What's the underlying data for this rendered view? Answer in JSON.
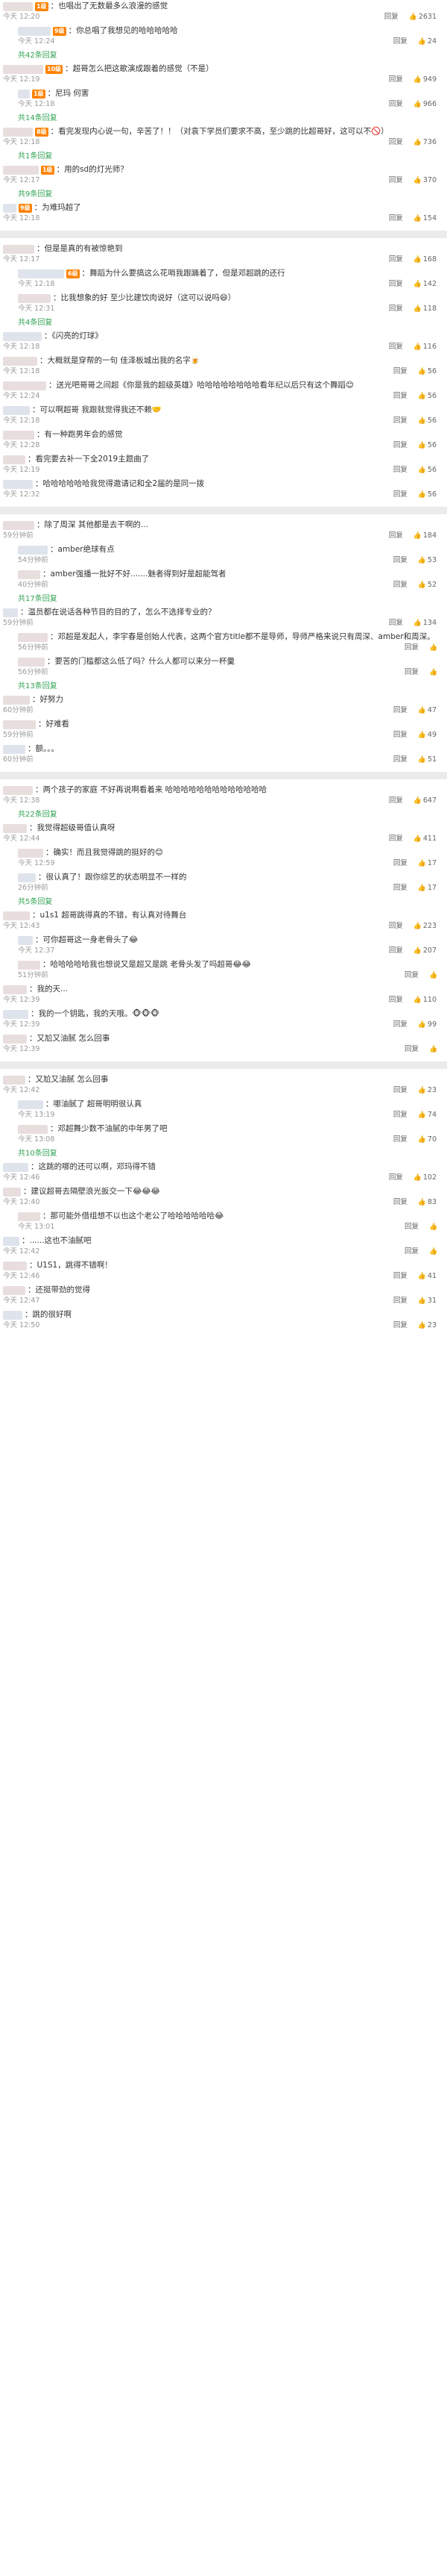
{
  "reply_label": "回复",
  "blocks": [
    {
      "rows": [
        {
          "reply": false,
          "name_w": 40,
          "badge": "1级",
          "text": "：也唱出了无数最多么浪漫的感觉",
          "time": "今天 12:20",
          "likes": "2631"
        },
        {
          "reply": true,
          "name_w": 44,
          "badge": "9级",
          "text": "：你总唱了我想见的哈哈哈哈哈",
          "time": "今天 12:24",
          "likes": "24"
        },
        {
          "more": "共42条回复",
          "reply": true
        },
        {
          "reply": false,
          "name_w": 54,
          "badge": "10级",
          "text": "：超哥怎么把这歌演成跟着的感觉（不是）",
          "time": "今天 12:19",
          "likes": "949"
        },
        {
          "reply": true,
          "name_w": 16,
          "badge": "1级",
          "text": "：尼玛 何害",
          "time": "今天 12:18",
          "likes": "966"
        },
        {
          "more": "共14条回复",
          "reply": true
        },
        {
          "reply": false,
          "name_w": 40,
          "badge": "8级",
          "text": "：看完发现内心说一句，辛苦了！！（对袁下学员们要求不高，至少跳的比超哥好，这可以不🚫）",
          "time": "今天 12:18",
          "likes": "736"
        },
        {
          "more": "共1条回复",
          "reply": true
        },
        {
          "reply": false,
          "name_w": 48,
          "badge": "1级",
          "text": "：用的sd的灯光师？",
          "time": "今天 12:17",
          "likes": "370"
        },
        {
          "more": "共9条回复",
          "reply": true
        },
        {
          "reply": false,
          "name_w": 18,
          "badge": "9级",
          "text": "：为难玛超了",
          "time": "今天 12:18",
          "likes": "154"
        }
      ]
    },
    {
      "rows": [
        {
          "reply": false,
          "name_w": 42,
          "badge": "",
          "text": "：但是是真的有被惊艳到",
          "time": "今天 12:17",
          "likes": "168"
        },
        {
          "reply": true,
          "name_w": 62,
          "badge": "6级",
          "text": "：舞蹈为什么要搞这么花哨我跟踊着了，但是邓超跳的还行",
          "time": "今天 12:18",
          "likes": "142"
        },
        {
          "reply": true,
          "name_w": 44,
          "badge": "",
          "text": "：比我想象的好 至少比建饮肉说好（这可以说吗😄）",
          "time": "今天 12:31",
          "likes": "118"
        },
        {
          "more": "共4条回复",
          "reply": true
        },
        {
          "reply": false,
          "name_w": 52,
          "badge": "",
          "text": "：《闪亮的灯球》",
          "time": "今天 12:18",
          "likes": "116"
        },
        {
          "reply": false,
          "name_w": 46,
          "badge": "",
          "text": "：大概就是穿帮的一句 佳泽板城出我的名字🍺",
          "time": "今天 12:18",
          "likes": "56"
        },
        {
          "reply": false,
          "name_w": 58,
          "badge": "",
          "text": "：送光吧哥哥之间超《你是我的超级英雄》哈哈哈哈哈哈哈哈看年纪以后只有这个舞蹈😊",
          "time": "今天 12:24",
          "likes": "56"
        },
        {
          "reply": false,
          "name_w": 36,
          "badge": "",
          "text": "：可以啊超哥 我跟就觉得我还不赖🤝",
          "time": "今天 12:18",
          "likes": "56"
        },
        {
          "reply": false,
          "name_w": 42,
          "badge": "",
          "text": "：有一种跑男年会的感觉",
          "time": "今天 12:28",
          "likes": "56"
        },
        {
          "reply": false,
          "name_w": 30,
          "badge": "",
          "text": "：看完要去补一下全2019主题曲了",
          "time": "今天 12:19",
          "likes": "56"
        },
        {
          "reply": false,
          "name_w": 40,
          "badge": "",
          "text": "：哈哈哈哈哈哈我觉得邀请记和全2届的是同一拨",
          "time": "今天 12:32",
          "likes": "56"
        }
      ]
    },
    {
      "rows": [
        {
          "reply": false,
          "name_w": 42,
          "badge": "",
          "text": "：除了周深 其他都是去干啊的...",
          "time": "59分钟前",
          "likes": "184"
        },
        {
          "reply": true,
          "name_w": 40,
          "badge": "",
          "text": "：amber绝球有点",
          "time": "54分钟前",
          "likes": "53"
        },
        {
          "reply": true,
          "name_w": 30,
          "badge": "",
          "text": "：amber强播一批好不好.......魅者得到好是超能驾者",
          "time": "40分钟前",
          "likes": "52"
        },
        {
          "more": "共17条回复",
          "reply": true
        },
        {
          "reply": false,
          "name_w": 0,
          "badge": "",
          "text": "：温员都在说话各种节目的目的了，怎么不选择专业的？",
          "time": "59分钟前",
          "likes": "134"
        },
        {
          "reply": true,
          "name_w": 40,
          "badge": "",
          "text": "：邓超是发起人，李宇春是创始人代表，这两个官方title都不是导师，导师严格来说只有周深、amber和周深。",
          "time": "56分钟前",
          "likes": ""
        },
        {
          "reply": true,
          "name_w": 36,
          "badge": "",
          "text": "：要苦的门槛都这么低了吗？什么人都可以来分一杯羹",
          "time": "56分钟前",
          "likes": ""
        },
        {
          "more": "共13条回复",
          "reply": true
        },
        {
          "reply": false,
          "name_w": 36,
          "badge": "",
          "text": "：好努力",
          "time": "60分钟前",
          "likes": "47"
        },
        {
          "reply": false,
          "name_w": 44,
          "badge": "",
          "text": "：好难看",
          "time": "59分钟前",
          "likes": "49"
        },
        {
          "reply": false,
          "name_w": 30,
          "badge": "",
          "text": "：额。。。",
          "time": "60分钟前",
          "likes": "51"
        }
      ]
    },
    {
      "rows": [
        {
          "reply": false,
          "name_w": 40,
          "badge": "",
          "text": "：两个孩子的家庭 不好再说啊看着来 哈哈哈哈哈哈哈哈哈哈哈哈哈",
          "time": "今天 12:38",
          "likes": "647"
        },
        {
          "more": "共22条回复",
          "reply": true
        },
        {
          "reply": false,
          "name_w": 32,
          "badge": "",
          "text": "：我觉得超级哥值认真呀",
          "time": "今天 12:44",
          "likes": "411"
        },
        {
          "reply": true,
          "name_w": 34,
          "badge": "",
          "text": "：确实！而且我觉得跳的挺好的😊",
          "time": "今天 12:59",
          "likes": "17"
        },
        {
          "reply": true,
          "name_w": 24,
          "badge": "",
          "text": "：很认真了！跟你综艺的状态明显不一样的",
          "time": "26分钟前",
          "likes": "17"
        },
        {
          "more": "共5条回复",
          "reply": true
        },
        {
          "reply": false,
          "name_w": 36,
          "badge": "",
          "text": "：u1s1 超哥跳得真的不错，有认真对待舞台",
          "time": "今天 12:43",
          "likes": "223"
        },
        {
          "reply": true,
          "name_w": 20,
          "badge": "",
          "text": "：可你超哥这一身老骨头了😂",
          "time": "今天 12:37",
          "likes": "207"
        },
        {
          "reply": true,
          "name_w": 30,
          "badge": "",
          "text": "：哈哈哈哈哈我也想说又是超又是跳 老骨头发了吗超哥😂😂",
          "time": "51分钟前",
          "likes": ""
        },
        {
          "reply": false,
          "name_w": 32,
          "badge": "",
          "text": "：我的天...",
          "time": "今天 12:39",
          "likes": "110"
        },
        {
          "reply": false,
          "name_w": 34,
          "badge": "",
          "text": "：我的一个钥匙，我的天哦。🐵🐵🐵",
          "time": "今天 12:39",
          "likes": "99"
        },
        {
          "reply": false,
          "name_w": 32,
          "badge": "",
          "text": "：又尬又油腻 怎么回事",
          "time": "今天 12:39",
          "likes": ""
        }
      ]
    },
    {
      "rows": [
        {
          "reply": false,
          "name_w": 30,
          "badge": "",
          "text": "：又尬又油腻 怎么回事",
          "time": "今天 12:42",
          "likes": "23"
        },
        {
          "reply": true,
          "name_w": 34,
          "badge": "",
          "text": "：哪油腻了 超哥明明很认真",
          "time": "今天 13:19",
          "likes": "74"
        },
        {
          "reply": true,
          "name_w": 40,
          "badge": "",
          "text": "：邓超舞少数不油腻的中年男了吧",
          "time": "今天 13:08",
          "likes": "70"
        },
        {
          "more": "共10条回复",
          "reply": true
        },
        {
          "reply": false,
          "name_w": 34,
          "badge": "",
          "text": "：这跳的哪的还可以啊，邓玛得不错",
          "time": "今天 12:46",
          "likes": "102"
        },
        {
          "reply": false,
          "name_w": 24,
          "badge": "",
          "text": "：建议超哥去隔壁浪光扳交一下😂😂😂",
          "time": "今天 12:40",
          "likes": "83"
        },
        {
          "reply": true,
          "name_w": 30,
          "badge": "",
          "text": "：那可能外借组想不以也这个老公了哈哈哈哈哈哈😂",
          "time": "今天 13:01",
          "likes": ""
        },
        {
          "reply": false,
          "name_w": 22,
          "badge": "",
          "text": "：......这也不油腻吧",
          "time": "今天 12:42",
          "likes": ""
        },
        {
          "reply": false,
          "name_w": 32,
          "badge": "",
          "text": "：U1S1，跳得不错啊！",
          "time": "今天 12:46",
          "likes": "41"
        },
        {
          "reply": false,
          "name_w": 30,
          "badge": "",
          "text": "：还挺带劲的觉得",
          "time": "今天 12:47",
          "likes": "31"
        },
        {
          "reply": false,
          "name_w": 26,
          "badge": "",
          "text": "：跳的很好啊",
          "time": "今天 12:50",
          "likes": "23"
        }
      ]
    }
  ]
}
